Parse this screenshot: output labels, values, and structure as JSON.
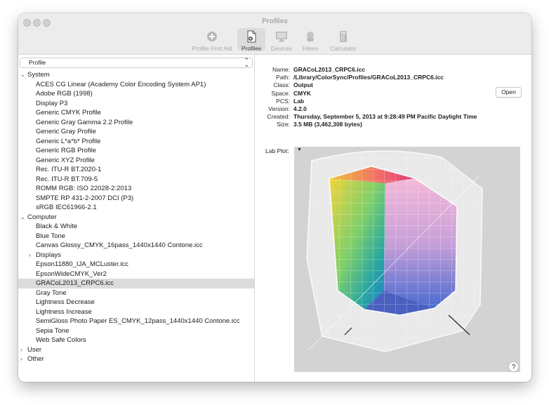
{
  "window": {
    "title": "Profiles"
  },
  "toolbar": {
    "items": [
      {
        "label": "Profile First Aid",
        "icon": "plus-circle-icon",
        "active": false
      },
      {
        "label": "Profiles",
        "icon": "profile-document-icon",
        "active": true
      },
      {
        "label": "Devices",
        "icon": "monitor-icon",
        "active": false
      },
      {
        "label": "Filters",
        "icon": "filter-icon",
        "active": false
      },
      {
        "label": "Calculator",
        "icon": "calculator-icon",
        "active": false
      }
    ]
  },
  "sidebar": {
    "popup_label": "Profile",
    "tree": [
      {
        "type": "group",
        "label": "System",
        "expanded": true
      },
      {
        "type": "item",
        "label": "ACES CG Linear (Academy Color Encoding System AP1)"
      },
      {
        "type": "item",
        "label": "Adobe RGB (1998)"
      },
      {
        "type": "item",
        "label": "Display P3"
      },
      {
        "type": "item",
        "label": "Generic CMYK Profile"
      },
      {
        "type": "item",
        "label": "Generic Gray Gamma 2.2 Profile"
      },
      {
        "type": "item",
        "label": "Generic Gray Profile"
      },
      {
        "type": "item",
        "label": "Generic L*a*b* Profile"
      },
      {
        "type": "item",
        "label": "Generic RGB Profile"
      },
      {
        "type": "item",
        "label": "Generic XYZ Profile"
      },
      {
        "type": "item",
        "label": "Rec. ITU-R BT.2020-1"
      },
      {
        "type": "item",
        "label": "Rec. ITU-R BT.709-5"
      },
      {
        "type": "item",
        "label": "ROMM RGB: ISO 22028-2:2013"
      },
      {
        "type": "item",
        "label": "SMPTE RP 431-2-2007 DCI (P3)"
      },
      {
        "type": "item",
        "label": "sRGB IEC61966-2.1"
      },
      {
        "type": "group",
        "label": "Computer",
        "expanded": true
      },
      {
        "type": "item",
        "label": "Black & White"
      },
      {
        "type": "item",
        "label": "Blue Tone"
      },
      {
        "type": "item",
        "label": "Canvas Glossy_CMYK_16pass_1440x1440 Contone.icc"
      },
      {
        "type": "subgroup",
        "label": "Displays",
        "expanded": false
      },
      {
        "type": "item",
        "label": "Epson11880_IJA_MCLuster.icc"
      },
      {
        "type": "item",
        "label": "EpsonWideCMYK_Ver2"
      },
      {
        "type": "item",
        "label": "GRACoL2013_CRPC6.icc",
        "selected": true
      },
      {
        "type": "item",
        "label": "Gray Tone"
      },
      {
        "type": "item",
        "label": "Lightness Decrease"
      },
      {
        "type": "item",
        "label": "Lightness Increase"
      },
      {
        "type": "item",
        "label": "SemiGloss Photo Paper ES_CMYK_12pass_1440x1440 Contone.icc"
      },
      {
        "type": "item",
        "label": "Sepia Tone"
      },
      {
        "type": "item",
        "label": "Web Safe Colors"
      },
      {
        "type": "group",
        "label": "User",
        "expanded": false
      },
      {
        "type": "group",
        "label": "Other",
        "expanded": false
      }
    ]
  },
  "details": {
    "fields": [
      {
        "label": "Name:",
        "value": "GRACoL2013_CRPC6.icc"
      },
      {
        "label": "Path:",
        "value": "/Library/ColorSync/Profiles/GRACoL2013_CRPC6.icc"
      },
      {
        "label": "Class:",
        "value": "Output"
      },
      {
        "label": "Space:",
        "value": "CMYK"
      },
      {
        "label": "PCS:",
        "value": "Lab"
      },
      {
        "label": "Version:",
        "value": "4.2.0"
      },
      {
        "label": "Created:",
        "value": "Thursday, September 5, 2013 at 9:28:49 PM Pacific Daylight Time"
      },
      {
        "label": "Size:",
        "value": "3.5 MB (3,462,308 bytes)"
      }
    ],
    "open_button": "Open",
    "lab_plot_label": "Lab Plot:"
  },
  "help_button": "?"
}
